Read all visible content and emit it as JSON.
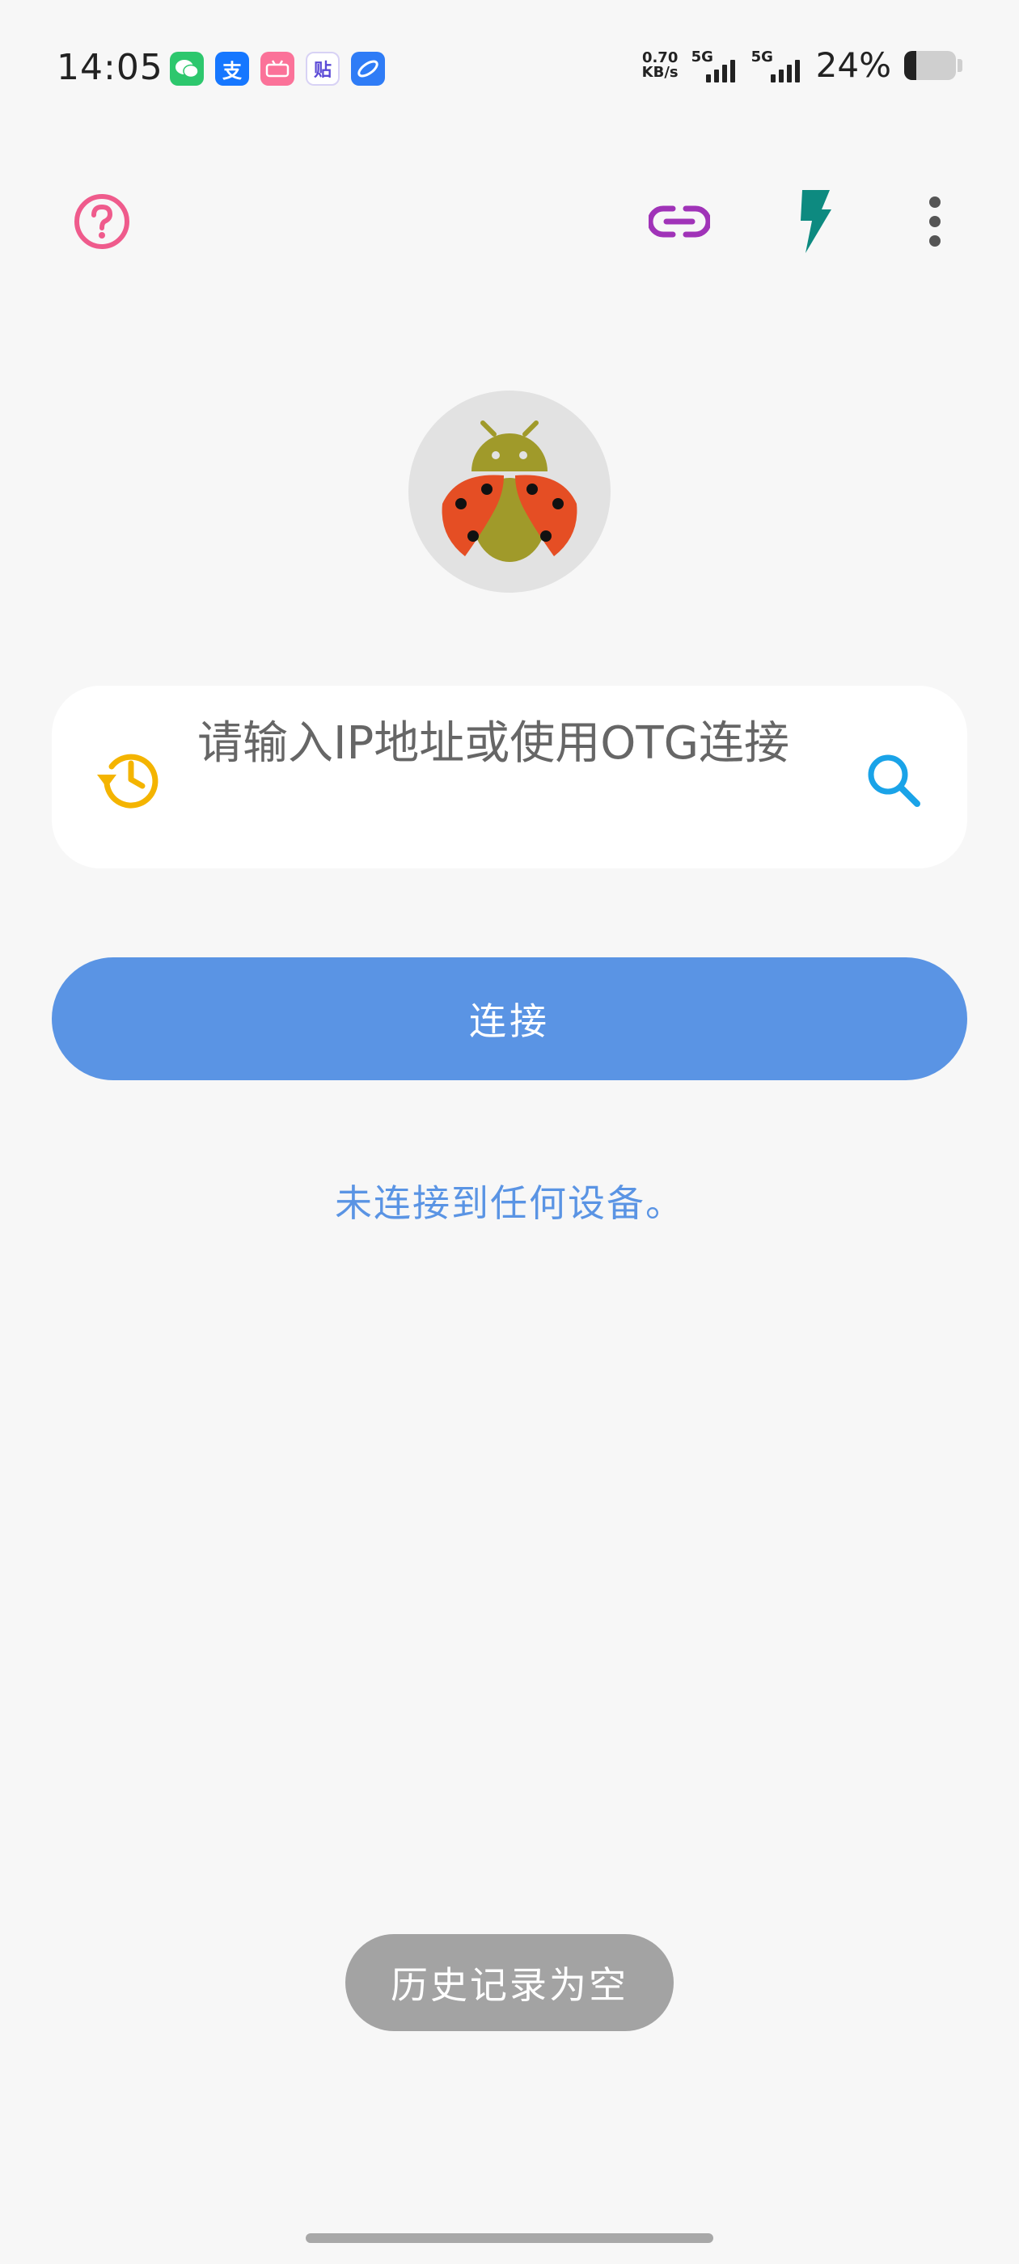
{
  "status_bar": {
    "time": "14:05",
    "net_speed_value": "0.70",
    "net_speed_unit": "KB/s",
    "sim1_label": "5G",
    "sim2_label": "5G",
    "battery_percent": "24%",
    "battery_level": 0.24,
    "apps": [
      {
        "name": "wechat-icon",
        "color": "#2dc76d"
      },
      {
        "name": "alipay-icon",
        "color": "#1677ff",
        "glyph": "支"
      },
      {
        "name": "bilibili-icon",
        "color": "#fb7299"
      },
      {
        "name": "tieba-icon",
        "color": "#5b4ad6",
        "glyph": "贴"
      },
      {
        "name": "browser-icon",
        "color": "#2f7cf6"
      }
    ]
  },
  "toolbar": {
    "help_icon_color": "#ef5b8c",
    "link_icon_color": "#a033b8",
    "flash_icon_color": "#0d8a80",
    "menu_icon_color": "#555555"
  },
  "input": {
    "placeholder": "请输入IP地址或使用OTG连接",
    "value": ""
  },
  "connect_button": {
    "label": "连接",
    "color": "#5a94e4"
  },
  "connection_status": "未连接到任何设备。",
  "toast": "历史记录为空"
}
